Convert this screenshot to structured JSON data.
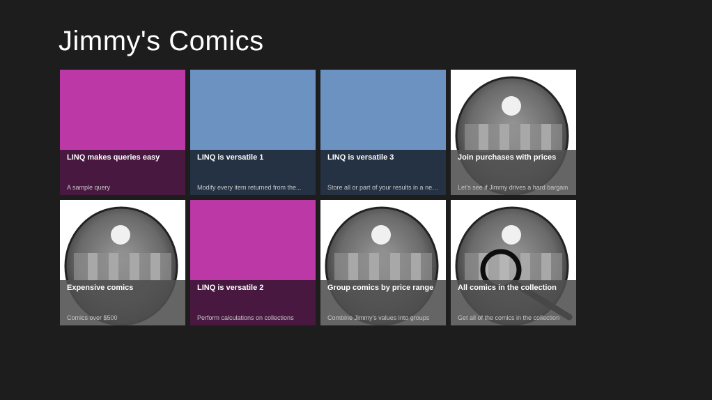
{
  "app": {
    "title": "Jimmy's Comics"
  },
  "colors": {
    "background": "#1d1d1d",
    "magenta_tile": "#bc38a6",
    "blue_tile": "#6c92c2"
  },
  "tiles": [
    {
      "title": "LINQ makes queries easy",
      "subtitle": "A sample query",
      "style": "magenta",
      "icon": ""
    },
    {
      "title": "LINQ is versatile 1",
      "subtitle": "Modify every item returned from the...",
      "style": "blue",
      "icon": ""
    },
    {
      "title": "LINQ is versatile 3",
      "subtitle": "Store all or part of your results in a new...",
      "style": "blue",
      "icon": ""
    },
    {
      "title": "Join purchases with prices",
      "subtitle": "Let's see if Jimmy drives a hard bargain",
      "style": "image",
      "icon": "comic-cover-icon"
    },
    {
      "title": "Expensive comics",
      "subtitle": "Comics over $500",
      "style": "image",
      "icon": "comic-cover-icon"
    },
    {
      "title": "LINQ is versatile 2",
      "subtitle": "Perform calculations on collections",
      "style": "magenta",
      "icon": ""
    },
    {
      "title": "Group comics by price range",
      "subtitle": "Combine Jimmy's values into groups",
      "style": "image",
      "icon": "comic-cover-icon"
    },
    {
      "title": "All comics in the collection",
      "subtitle": "Get all of the comics in the collection",
      "style": "image",
      "icon": "magnifier-comic-icon"
    }
  ]
}
